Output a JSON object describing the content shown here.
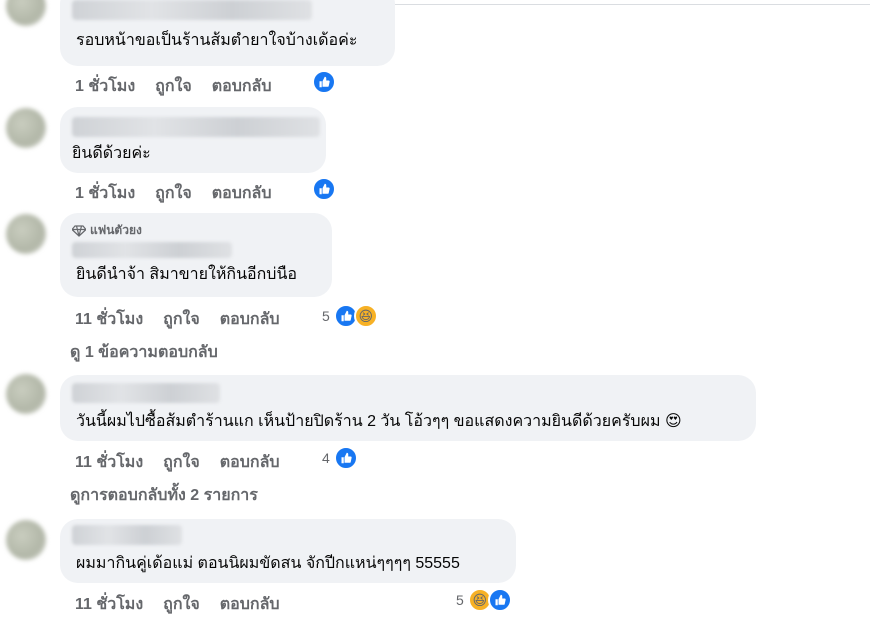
{
  "comments": [
    {
      "text": "รอบหน้าขอเป็นร้านส้มตำยาใจบ้างเด้อค่ะ",
      "time": "1 ชั่วโมง",
      "like_label": "ถูกใจ",
      "reply_label": "ตอบกลับ",
      "reactions": [
        "like-icon"
      ]
    },
    {
      "text": "ยินดีด้วยค่ะ",
      "time": "1 ชั่วโมง",
      "like_label": "ถูกใจ",
      "reply_label": "ตอบกลับ",
      "reactions": [
        "like-icon"
      ]
    },
    {
      "badge": "แฟนตัวยง",
      "text": "ยินดีนำจ้า สิมาขายให้กินอีกบ่นือ",
      "time": "11 ชั่วโมง",
      "like_label": "ถูกใจ",
      "reply_label": "ตอบกลับ",
      "reaction_count": "5",
      "reactions": [
        "like-icon",
        "haha-icon"
      ],
      "view_replies": "ดู 1 ข้อความตอบกลับ"
    },
    {
      "text": "วันนี้ผมไปซื้อส้มตำร้านแก เห็นป้ายปิดร้าน 2 วัน โอ้วๆๆ ขอแสดงความยินดีด้วยครับผม",
      "emoji": "😍",
      "time": "11 ชั่วโมง",
      "like_label": "ถูกใจ",
      "reply_label": "ตอบกลับ",
      "reaction_count": "4",
      "reactions": [
        "like-icon"
      ],
      "view_replies": "ดูการตอบกลับทั้ง 2 รายการ"
    },
    {
      "text": "ผมมากินคู่เด้อแม่ ตอนนิผมขัดสน จักปีกแหน่ๆๆๆๆ 55555",
      "time": "11 ชั่วโมง",
      "like_label": "ถูกใจ",
      "reply_label": "ตอบกลับ",
      "reaction_count": "5",
      "reactions": [
        "haha-icon",
        "like-icon"
      ]
    }
  ],
  "colors": {
    "bubble": "#f0f2f5",
    "like": "#1877f2",
    "meta": "#65676b"
  }
}
